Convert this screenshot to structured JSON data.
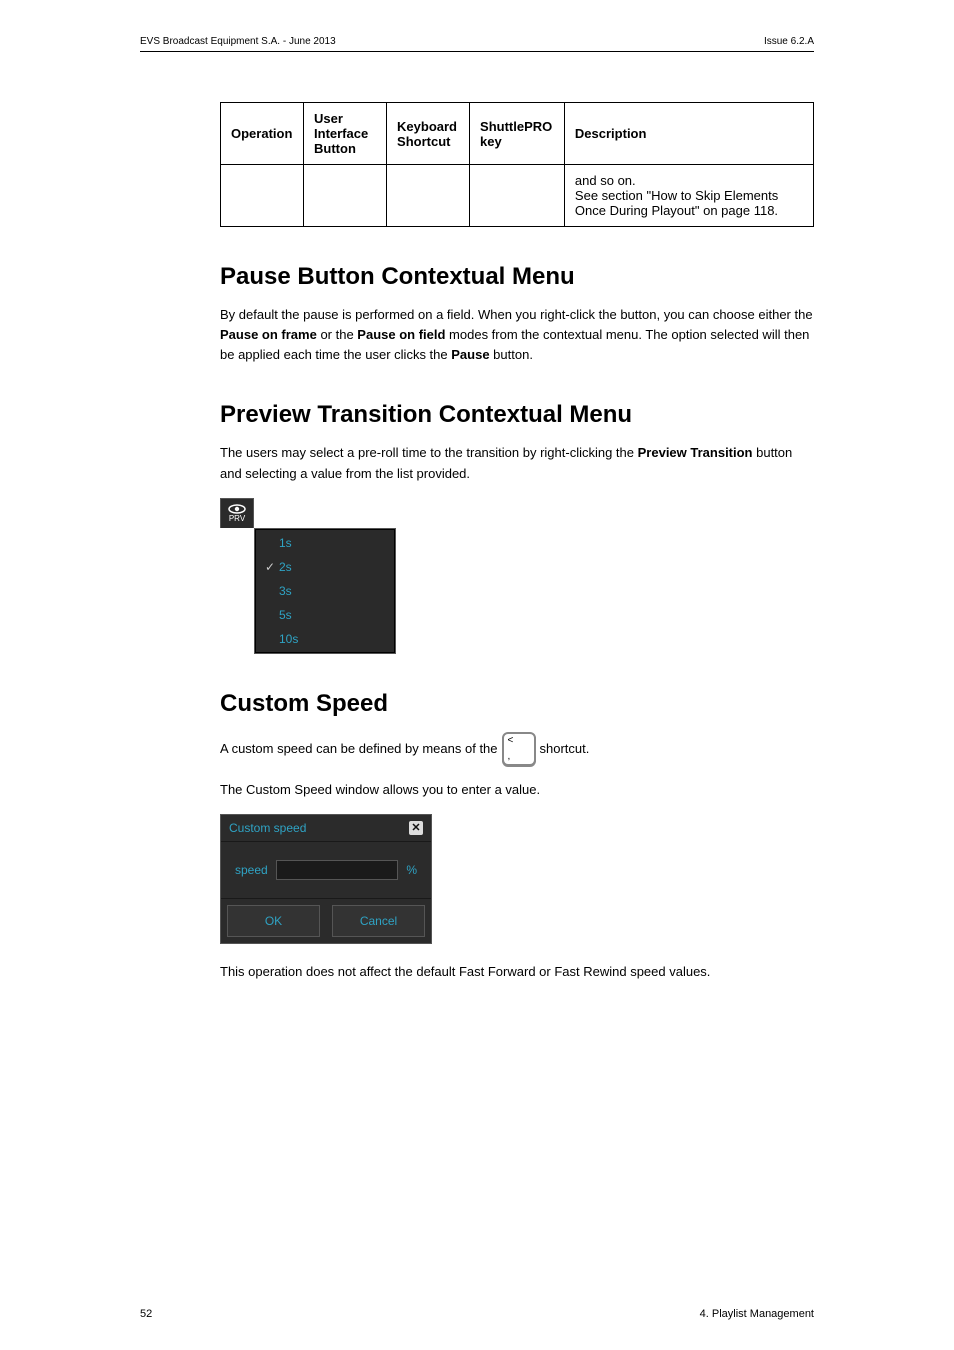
{
  "meta": {
    "header_left": "EVS Broadcast Equipment S.A.  - June 2013",
    "header_right": "Issue 6.2.A",
    "footer_left": "52",
    "footer_right": "4. Playlist Management"
  },
  "table": {
    "headers": [
      "Operation",
      "User Interface Button",
      "Keyboard Shortcut",
      "ShuttlePRO key",
      "Description"
    ],
    "row_desc": "and so on.\nSee section \"How to Skip Elements Once During Playout\" on page 118."
  },
  "pause": {
    "heading": "Pause Button Contextual Menu",
    "para_parts": [
      "By default the pause is performed on a field. When you right-click the button, you can choose either the ",
      "Pause on frame",
      " or the ",
      "Pause on field",
      " modes from the contextual menu. The option selected will then be applied each time the user clicks the ",
      "Pause",
      " button."
    ]
  },
  "preview": {
    "heading": "Preview Transition Contextual Menu",
    "para_parts": [
      "The users may select a pre-roll time to the transition by right-clicking the ",
      "Preview Transition",
      " button and selecting a value from the list provided."
    ],
    "corner_label": "PRV",
    "items": [
      {
        "label": "1s",
        "checked": false
      },
      {
        "label": "2s",
        "checked": true
      },
      {
        "label": "3s",
        "checked": false
      },
      {
        "label": "5s",
        "checked": false
      },
      {
        "label": "10s",
        "checked": false
      }
    ]
  },
  "custom": {
    "heading": "Custom Speed",
    "p1_before": "A custom speed can be defined by means of the ",
    "p1_after": " shortcut.",
    "key_top": "<",
    "key_bot": ",",
    "p2": "The Custom Speed window allows you to enter a value.",
    "dlg_title": "Custom speed",
    "dlg_close": "✕",
    "dlg_label": "speed",
    "dlg_pct": "%",
    "dlg_ok": "OK",
    "dlg_cancel": "Cancel",
    "p3": "This operation does not affect the default Fast Forward or Fast Rewind speed values."
  }
}
